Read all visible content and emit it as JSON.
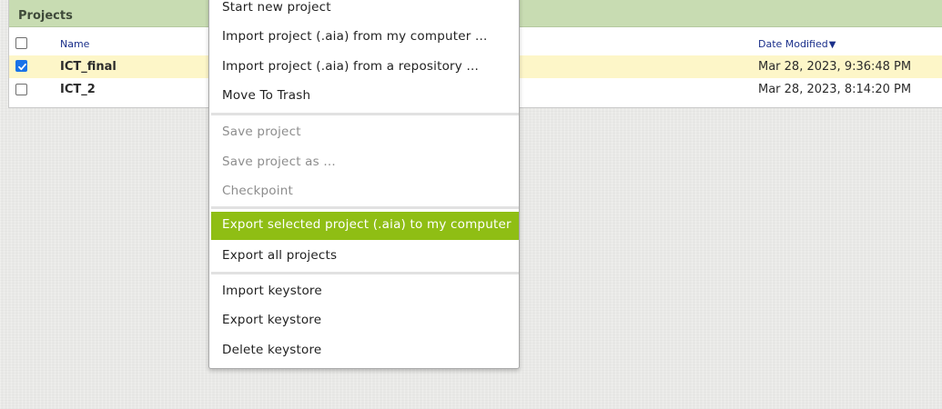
{
  "projects_panel": {
    "title": "Projects",
    "columns": {
      "name": "Name",
      "date_modified": "Date Modified",
      "sort_indicator": "▼"
    },
    "rows": [
      {
        "name": "ICT_final",
        "date": "Mar 28, 2023, 9:36:48 PM",
        "checked": true
      },
      {
        "name": "ICT_2",
        "date": "Mar 28, 2023, 8:14:20 PM",
        "checked": false
      }
    ]
  },
  "menu": {
    "items": [
      {
        "label": "Start new project",
        "state": "enabled"
      },
      {
        "label": "Import project (.aia) from my computer ...",
        "state": "enabled"
      },
      {
        "label": "Import project (.aia) from a repository ...",
        "state": "enabled"
      },
      {
        "label": "Move To Trash",
        "state": "enabled"
      },
      {
        "label": "Save project",
        "state": "disabled"
      },
      {
        "label": "Save project as ...",
        "state": "disabled"
      },
      {
        "label": "Checkpoint",
        "state": "disabled"
      },
      {
        "label": "Export selected project (.aia) to my computer",
        "state": "highlighted"
      },
      {
        "label": "Export all projects",
        "state": "enabled"
      },
      {
        "label": "Import keystore",
        "state": "enabled"
      },
      {
        "label": "Export keystore",
        "state": "enabled"
      },
      {
        "label": "Delete keystore",
        "state": "enabled"
      }
    ]
  },
  "colors": {
    "panel_header": "#c8dcb2",
    "selected_row": "#fdf6c8",
    "menu_highlight": "#8fbe14",
    "checkbox_checked": "#1a73e8",
    "column_header_text": "#1a2f8a"
  }
}
